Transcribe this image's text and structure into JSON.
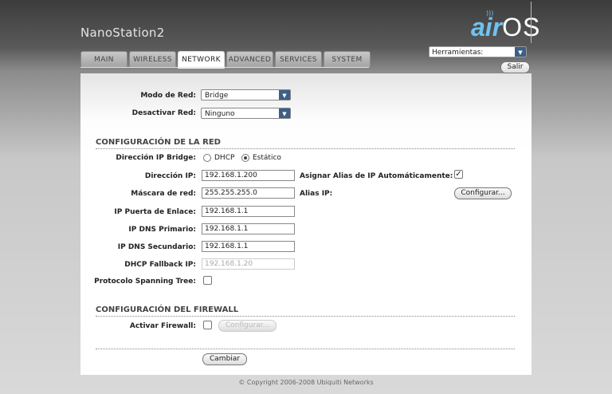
{
  "header": {
    "device": "NanoStation2",
    "logo_air": "air",
    "logo_os": "OS",
    "tools_select": "Herramientas:",
    "logout": "Salir"
  },
  "tabs": [
    {
      "label": "MAIN",
      "active": false
    },
    {
      "label": "WIRELESS",
      "active": false
    },
    {
      "label": "NETWORK",
      "active": true
    },
    {
      "label": "ADVANCED",
      "active": false
    },
    {
      "label": "SERVICES",
      "active": false
    },
    {
      "label": "SYSTEM",
      "active": false
    }
  ],
  "mode": {
    "network_mode_label": "Modo de Red:",
    "network_mode_value": "Bridge",
    "disable_network_label": "Desactivar Red:",
    "disable_network_value": "Ninguno"
  },
  "network": {
    "section_title": "CONFIGURACIÓN DE LA RED",
    "bridge_ip_label": "Dirección IP Bridge:",
    "dhcp_label": "DHCP",
    "static_label": "Estático",
    "ip_label": "Dirección IP:",
    "ip_value": "192.168.1.200",
    "auto_alias_label": "Asignar Alias de IP Automáticamente:",
    "netmask_label": "Máscara de red:",
    "netmask_value": "255.255.255.0",
    "alias_label": "Alias IP:",
    "configure_button": "Configurar...",
    "gateway_label": "IP Puerta de Enlace:",
    "gateway_value": "192.168.1.1",
    "dns1_label": "IP DNS Primario:",
    "dns1_value": "192.168.1.1",
    "dns2_label": "IP DNS Secundario:",
    "dns2_value": "192.168.1.1",
    "fallback_label": "DHCP Fallback IP:",
    "fallback_placeholder": "192.168.1.20",
    "stp_label": "Protocolo Spanning Tree:"
  },
  "firewall": {
    "section_title": "CONFIGURACIÓN DEL FIREWALL",
    "enable_label": "Activar Firewall:",
    "configure_button": "Configurar..."
  },
  "footer": {
    "change_button": "Cambiar",
    "copyright": "© Copyright 2006-2008 Ubiquiti Networks"
  }
}
